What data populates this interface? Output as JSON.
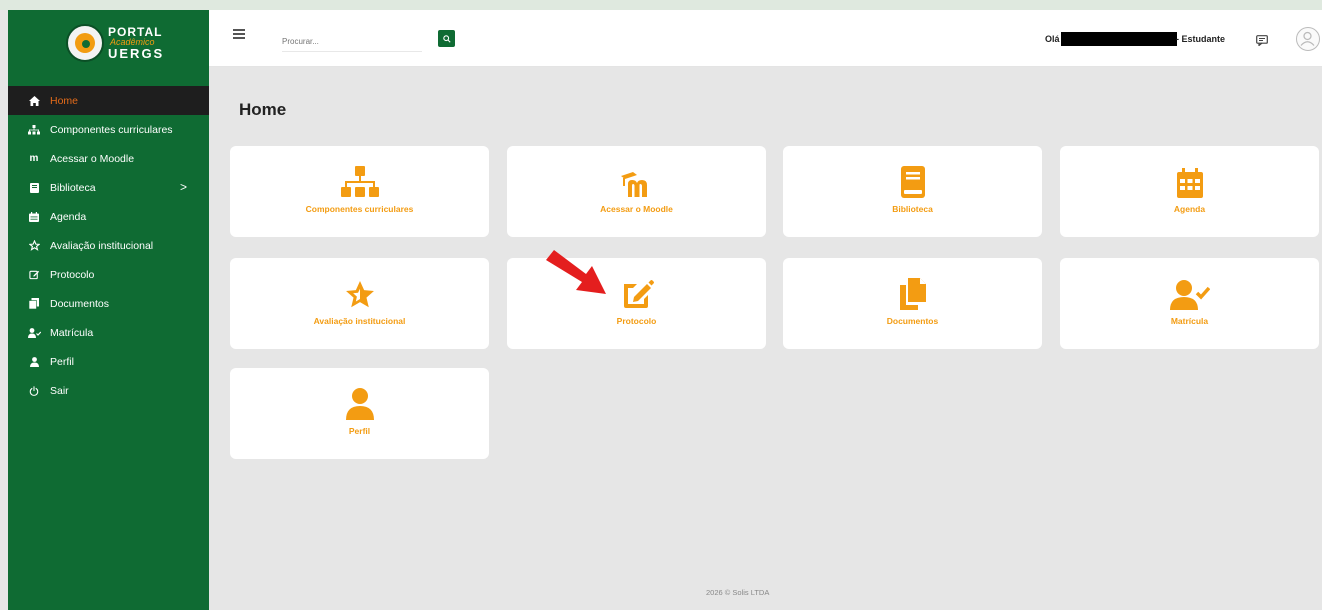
{
  "brand": {
    "line1": "PORTAL",
    "line2": "Acadêmico",
    "line3": "UERGS"
  },
  "sidebar": {
    "items": [
      {
        "label": "Home",
        "icon": "home-icon",
        "active": true
      },
      {
        "label": "Componentes curriculares",
        "icon": "sitemap-icon"
      },
      {
        "label": "Acessar o Moodle",
        "icon": "moodle-icon"
      },
      {
        "label": "Biblioteca",
        "icon": "book-icon",
        "chevron": ">"
      },
      {
        "label": "Agenda",
        "icon": "calendar-icon"
      },
      {
        "label": "Avaliação institucional",
        "icon": "star-icon"
      },
      {
        "label": "Protocolo",
        "icon": "edit-icon"
      },
      {
        "label": "Documentos",
        "icon": "documents-icon"
      },
      {
        "label": "Matrícula",
        "icon": "user-check-icon"
      },
      {
        "label": "Perfil",
        "icon": "user-icon"
      },
      {
        "label": "Sair",
        "icon": "power-icon"
      }
    ]
  },
  "header": {
    "search_placeholder": "Procurar...",
    "greeting": "Olá",
    "role": "- Estudante"
  },
  "main": {
    "title": "Home",
    "cards": [
      {
        "label": "Componentes curriculares",
        "icon": "sitemap-icon"
      },
      {
        "label": "Acessar o Moodle",
        "icon": "moodle-icon"
      },
      {
        "label": "Biblioteca",
        "icon": "book-icon"
      },
      {
        "label": "Agenda",
        "icon": "calendar-icon"
      },
      {
        "label": "Avaliação institucional",
        "icon": "star-icon"
      },
      {
        "label": "Protocolo",
        "icon": "edit-icon"
      },
      {
        "label": "Documentos",
        "icon": "documents-icon"
      },
      {
        "label": "Matrícula",
        "icon": "user-check-icon"
      },
      {
        "label": "Perfil",
        "icon": "user-icon"
      }
    ]
  },
  "footer": {
    "text": "2026 © Solis LTDA"
  },
  "colors": {
    "sidebar": "#0f6b33",
    "accent": "#f39c12",
    "active_item": "#e46b1a",
    "arrow": "#e41e1e"
  }
}
